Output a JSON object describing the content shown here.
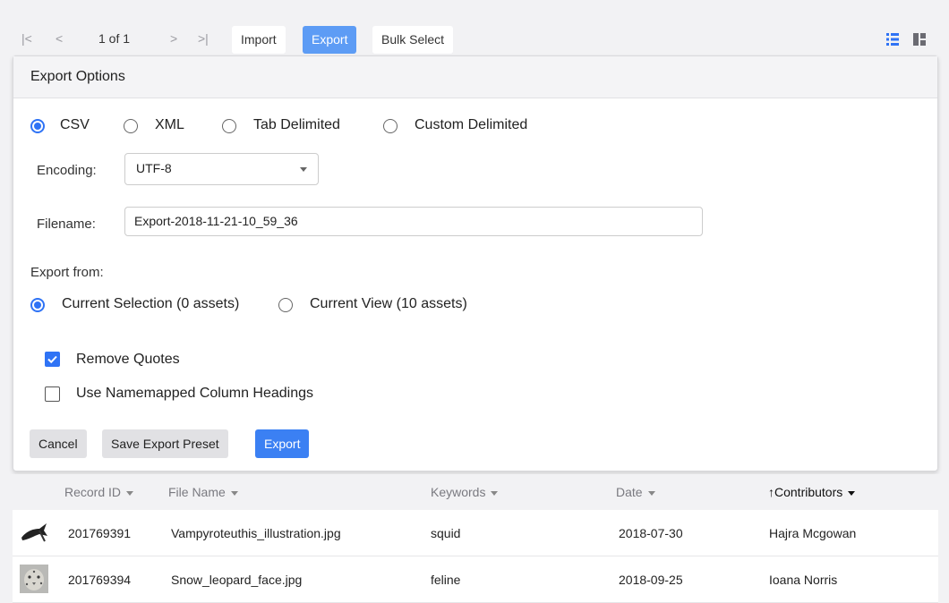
{
  "toolbar": {
    "pager": {
      "first_icon": "first-page-icon",
      "prev_icon": "prev-page-icon",
      "text": "1 of 1",
      "next_icon": "next-page-icon",
      "last_icon": "last-page-icon"
    },
    "import_label": "Import",
    "export_label": "Export",
    "bulk_select_label": "Bulk Select",
    "view_icons": [
      "list-view-icon",
      "grid-view-icon"
    ],
    "accent": "#5d9cf5"
  },
  "export_panel": {
    "title": "Export Options",
    "formats": [
      {
        "label": "CSV",
        "selected": true
      },
      {
        "label": "XML",
        "selected": false
      },
      {
        "label": "Tab Delimited",
        "selected": false
      },
      {
        "label": "Custom Delimited",
        "selected": false
      }
    ],
    "encoding": {
      "label": "Encoding:",
      "value": "UTF-8"
    },
    "filename": {
      "label": "Filename:",
      "value": "Export-2018-11-21-10_59_36"
    },
    "export_from": {
      "label": "Export from:",
      "options": [
        {
          "label": "Current Selection (0 assets)",
          "selected": true
        },
        {
          "label": "Current View (10 assets)",
          "selected": false
        }
      ]
    },
    "options": [
      {
        "label": "Remove Quotes",
        "checked": true
      },
      {
        "label": "Use Namemapped Column Headings",
        "checked": false
      }
    ],
    "buttons": {
      "cancel": "Cancel",
      "save_preset": "Save Export Preset",
      "export": "Export"
    },
    "primary_color": "#3b80f3"
  },
  "table": {
    "columns": [
      "Record ID",
      "File Name",
      "Keywords",
      "Date",
      "Contributors"
    ],
    "sorted_column": "Contributors",
    "sort_icon": "sort-ascending-arrow-icon",
    "rows": [
      {
        "thumb": "squid-illustration-thumbnail",
        "record_id": "201769391",
        "file_name": "Vampyroteuthis_illustration.jpg",
        "keywords": "squid",
        "date": "2018-07-30",
        "contributors": "Hajra Mcgowan"
      },
      {
        "thumb": "snow-leopard-thumbnail",
        "record_id": "201769394",
        "file_name": "Snow_leopard_face.jpg",
        "keywords": "feline",
        "date": "2018-09-25",
        "contributors": "Ioana Norris"
      }
    ]
  }
}
